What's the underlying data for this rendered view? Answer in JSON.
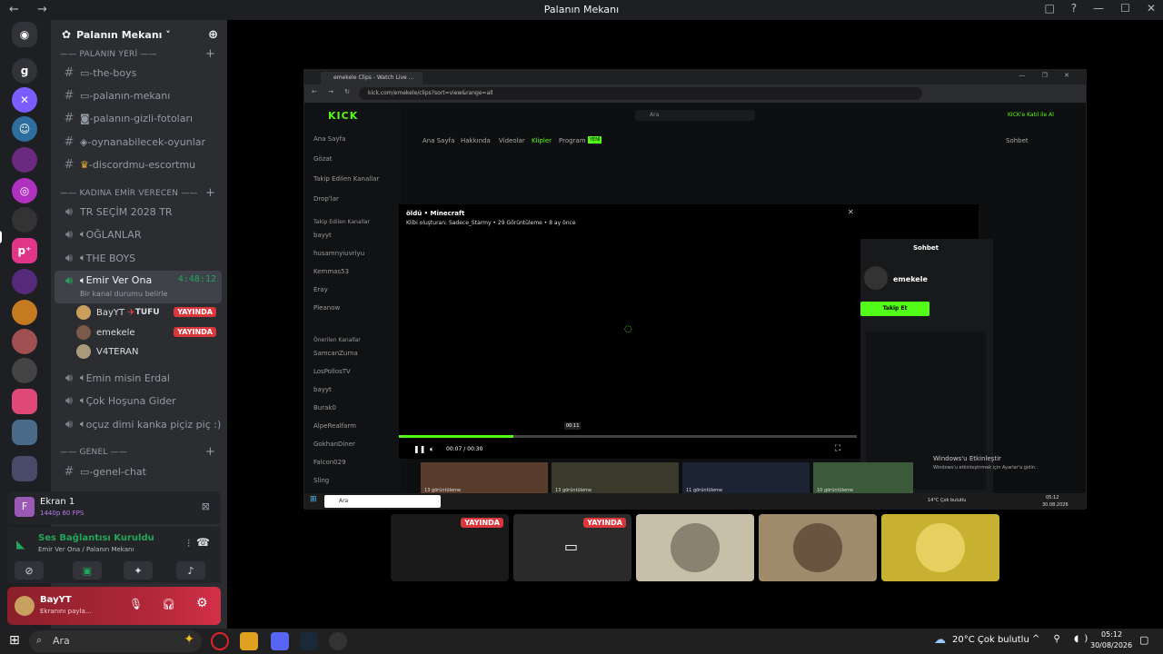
{
  "window": {
    "title": "Palanın Mekanı",
    "nav_arrows": "← →",
    "controls": [
      "□",
      "?",
      "—",
      "☐",
      "✕"
    ]
  },
  "server": {
    "name": "Palanın Mekanı ˅"
  },
  "categories": {
    "palanin_yeri": "—— PALANIN YERİ ——",
    "kadina": "—— KADINA EMİR VERECEN ——",
    "genel": "—— GENEL ——"
  },
  "text_channels": [
    "-the-boys",
    "-palanın-mekanı",
    "-palanın-gizli-fotoları",
    "-oynanabilecek-oyunlar",
    "-discordmu-escortmu"
  ],
  "voice_channels": [
    "TR SEÇİM 2028 TR",
    "OĞLANLAR",
    "THE BOYS"
  ],
  "active_channel": {
    "name": "Emir Ver Ona",
    "timer": "4:48:12",
    "status": "Bir kanal durumu belirle"
  },
  "members": [
    {
      "name": "BayYT",
      "tag": "TUFU",
      "live": "YAYINDA"
    },
    {
      "name": "emekele",
      "live": "YAYINDA"
    },
    {
      "name": "V4TERAN"
    }
  ],
  "more_voice": [
    "Emin misin Erdal",
    "Çok Hoşuna Gider",
    "oçuz dimi kanka piçiz piç :)"
  ],
  "genel_chat": "-genel-chat",
  "screen": {
    "title": "Ekran 1",
    "sub": "1440p 60 FPS"
  },
  "voice": {
    "status": "Ses Bağlantısı Kuruldu",
    "where": "Emir Ver Ona / Palanın Mekanı"
  },
  "user": {
    "name": "BayYT",
    "status": "Ekranını payla..."
  },
  "browser": {
    "tab_title": "emekele Clips - Watch Live ...",
    "url": "kick.com/emekele/clips?sort=view&range=all",
    "kick_logo": "KICK",
    "search_placeholder": "Ara",
    "sidebar": [
      "Ana Sayfa",
      "Gözat",
      "Takip Edilen Kanallar",
      "Drop'lar"
    ],
    "followed_title": "Takip Edilen Kanallar",
    "followed": [
      "bayyt",
      "husamnyiuvriyu",
      "Kemmas53",
      "Eray",
      "Pleanow"
    ],
    "recommended_title": "Önerilen Kanallar",
    "recommended": [
      "SamcanZurna",
      "LosPollosTV",
      "bayyt",
      "Burak0",
      "AlpeRealfarm",
      "GokhanDiner",
      "Falcon029",
      "Sling"
    ],
    "tabs": [
      "Ana Sayfa",
      "Hakkında",
      "Videolar",
      "Klipler",
      "Program"
    ],
    "program_badge": "YENİ",
    "clip_title": "öldü • Minecraft",
    "clip_meta": "Klibi oluşturan: Sadece_Starmy • 29 Görüntüleme • 8 ay önce",
    "time": "00:07 / 00:30",
    "hover_time": "00:11",
    "chat_title": "Sohbet",
    "streamer": "emekele",
    "follow": "Takip Et",
    "windows_title": "Windows'u Etkinleştir",
    "windows_sub": "Windows'u etkinleştirmek için Ayarlar'a gidin.",
    "win_search": "Ara",
    "win_weather": "14°C Çok bulutlu",
    "win_time": "05:12",
    "win_date": "30.08.2026",
    "views": [
      "13 görüntüleme",
      "13 görüntüleme",
      "11 görüntüleme",
      "10 görüntüleme"
    ],
    "kick_signin": "KICK'e Katıl ile Al",
    "sohbet_head": "Sohbet"
  },
  "tiles": {
    "live1": "YAYINDA",
    "live2": "YAYINDA"
  },
  "taskbar": {
    "search": "Ara",
    "weather": "20°C  Çok bulutlu",
    "time": "05:12",
    "date": "30/08/2026"
  },
  "colors": {
    "accent_green": "#53fc18",
    "live_red": "#da373c",
    "discord_bg": "#2b2d31"
  }
}
